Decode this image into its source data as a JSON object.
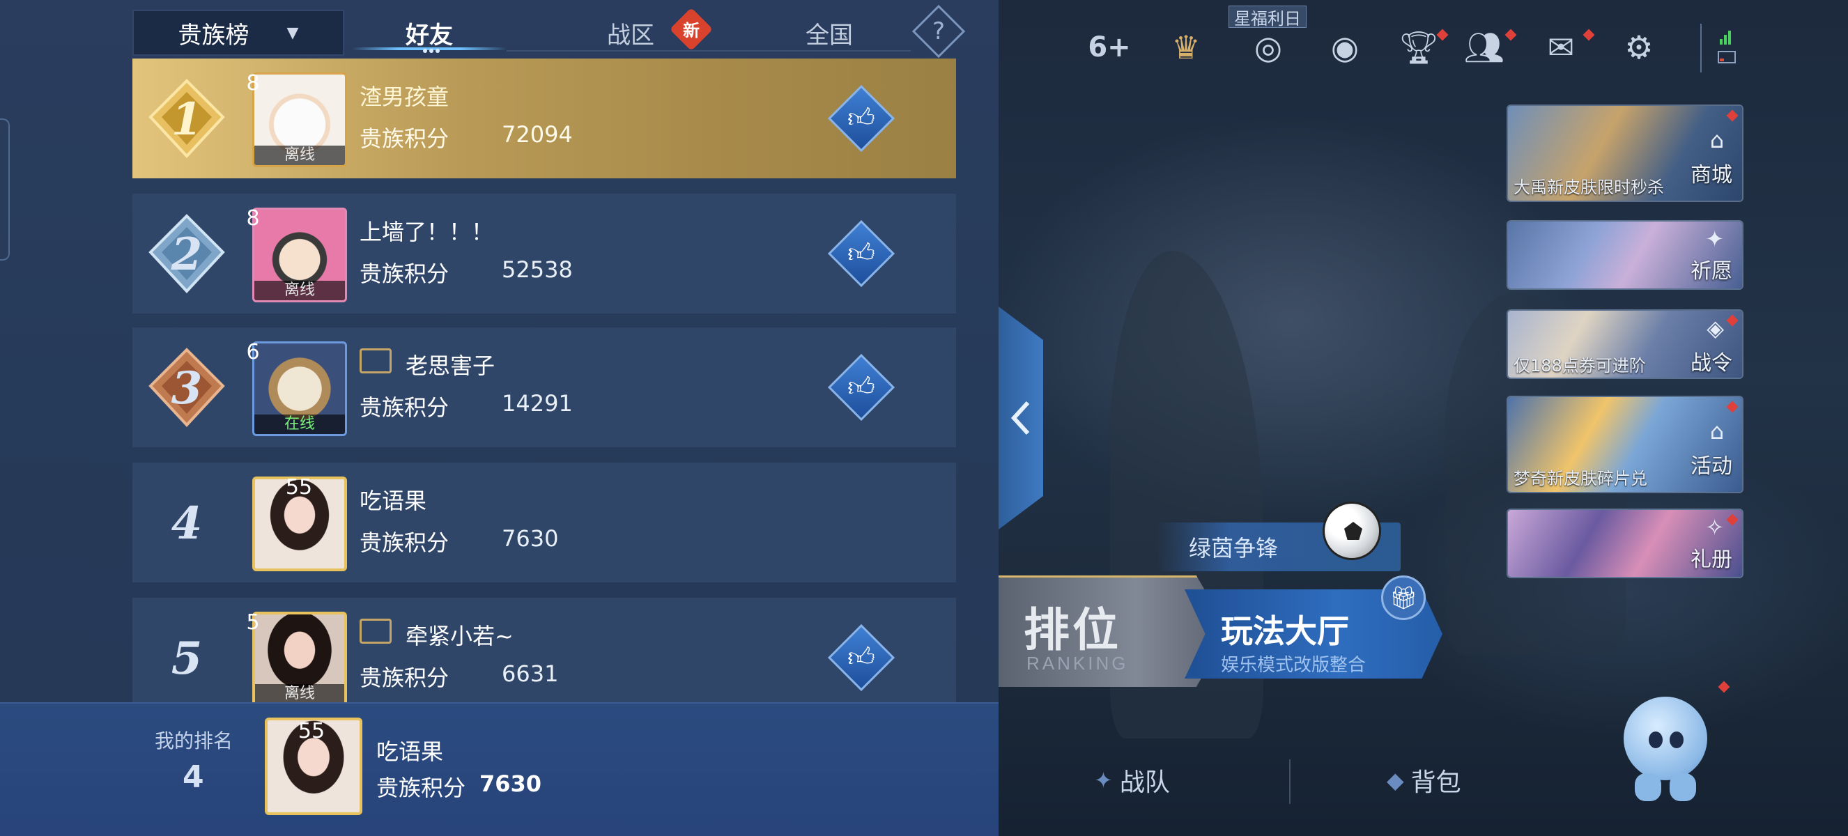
{
  "tabs": {
    "dropdown": "贵族榜",
    "friends": "好友",
    "zone": "战区",
    "zone_badge": "新",
    "national": "全国",
    "help": "?"
  },
  "rows": [
    {
      "rank": "1",
      "level": "8",
      "name": "渣男孩童",
      "score_label": "贵族积分",
      "score": "72094",
      "status": "离线",
      "has_like": true
    },
    {
      "rank": "2",
      "level": "8",
      "name": "上墙了！！！",
      "score_label": "贵族积分",
      "score": "52538",
      "status": "离线",
      "has_like": true
    },
    {
      "rank": "3",
      "level": "6",
      "name": "老思害子",
      "score_label": "贵族积分",
      "score": "14291",
      "status": "在线",
      "has_like": true
    },
    {
      "rank": "4",
      "level": "55",
      "name": "吃语果",
      "score_label": "贵族积分",
      "score": "7630",
      "status": "",
      "has_like": false
    },
    {
      "rank": "5",
      "level": "5",
      "name": "牵紧小若~",
      "score_label": "贵族积分",
      "score": "6631",
      "status": "离线",
      "has_like": true
    }
  ],
  "my_rank": {
    "label": "我的排名",
    "rank": "4",
    "level": "55",
    "name": "吃语果",
    "score_label": "贵族积分",
    "score": "7630"
  },
  "lobby": {
    "top_counter": "6+",
    "star_day": "星福利日",
    "side_cards": [
      {
        "caption": "大禹新皮肤限时秒杀",
        "label": "商城"
      },
      {
        "caption": "",
        "label": "祈愿"
      },
      {
        "caption": "仅188点券可进阶",
        "label": "战令"
      },
      {
        "caption": "梦奇新皮肤碎片兑",
        "label": "活动"
      },
      {
        "caption": "",
        "label": "礼册"
      }
    ],
    "green_event": "绿茵争锋",
    "rank_button": {
      "title": "排位",
      "subtitle": "RANKING"
    },
    "hall_button": {
      "title": "玩法大厅",
      "subtitle": "娱乐模式改版整合"
    },
    "bottom_tabs": {
      "team": "战队",
      "bag": "背包"
    }
  },
  "colors": {
    "panel_bg": "#263a59",
    "row_bg": "#304669",
    "gold_row": "#c9ab63",
    "like_blue": "#2f68be",
    "accent_cyan": "#6fc2ff",
    "badge_red": "#d9432d"
  }
}
